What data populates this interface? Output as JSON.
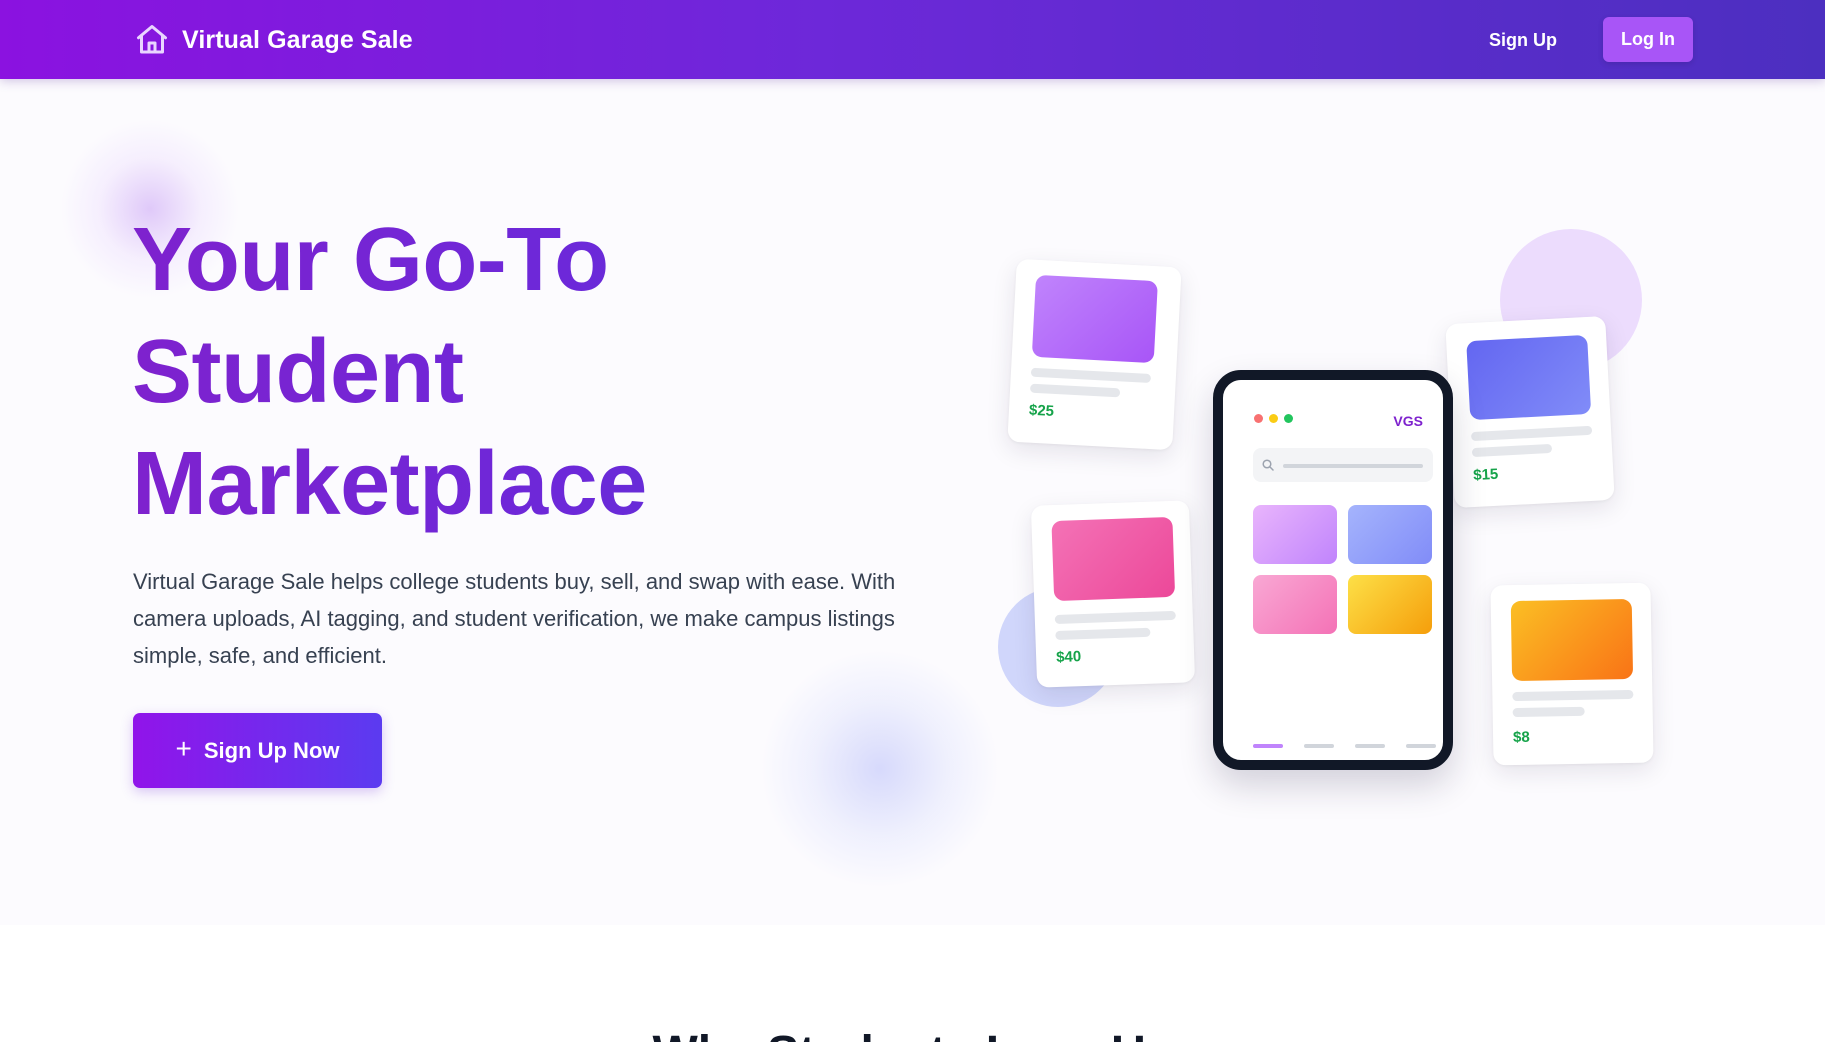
{
  "navbar": {
    "brand": "Virtual Garage Sale",
    "brand_icon": "home-icon",
    "signup_label": "Sign Up",
    "login_label": "Log In",
    "colors": {
      "gradient_start": "#8b12e0",
      "gradient_end": "#4c2fc0",
      "login_bg": "#a855f7"
    }
  },
  "hero": {
    "title_lines": [
      "Your Go-To",
      "Student",
      "Marketplace"
    ],
    "description": "Virtual Garage Sale helps college students buy, sell, and swap with ease. With camera uploads, AI tagging, and student verification, we make campus listings simple, safe, and efficient.",
    "cta_icon": "plus-icon",
    "cta_label": "Sign Up Now",
    "colors": {
      "title": "#7e22ce",
      "cta_start": "#9114ea",
      "cta_end": "#5b3bf0"
    }
  },
  "illustration": {
    "cards": [
      {
        "price": "$25",
        "color": "#a855f7"
      },
      {
        "price": "$40",
        "color": "#ec4899"
      },
      {
        "price": "$15",
        "color": "#6366f1"
      },
      {
        "price": "$8",
        "color": "#f97316"
      }
    ],
    "phone": {
      "logo": "VGS",
      "search_icon": "search-icon",
      "tile_colors": [
        "#c084fc",
        "#818cf8",
        "#f472b6",
        "#fbbf24"
      ]
    },
    "price_color": "#16a34a"
  },
  "features": {
    "heading": "Why Students Love Us"
  }
}
